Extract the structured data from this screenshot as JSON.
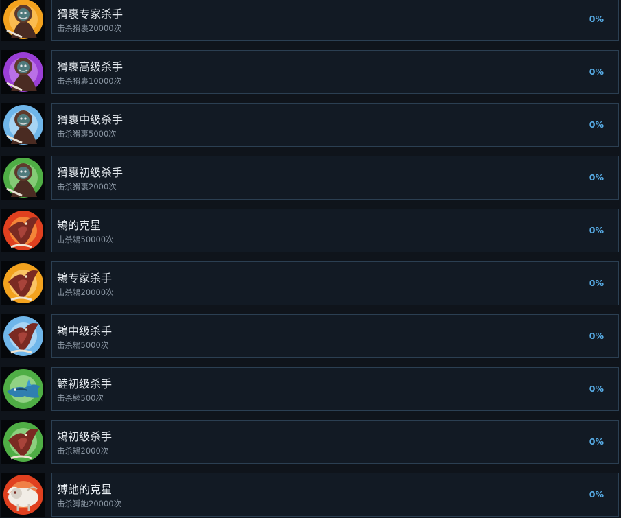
{
  "achievements": [
    {
      "title": "猾褢专家杀手",
      "desc": "击杀猾褢20000次",
      "progress": "0%",
      "icon": "masked-beast-icon",
      "tier": "gold"
    },
    {
      "title": "猾褢高级杀手",
      "desc": "击杀猾褢10000次",
      "progress": "0%",
      "icon": "masked-beast-icon",
      "tier": "purple"
    },
    {
      "title": "猾褢中级杀手",
      "desc": "击杀猾褢5000次",
      "progress": "0%",
      "icon": "masked-beast-icon",
      "tier": "blue"
    },
    {
      "title": "猾褢初级杀手",
      "desc": "击杀猾褢2000次",
      "progress": "0%",
      "icon": "masked-beast-icon",
      "tier": "green"
    },
    {
      "title": "鴸的克星",
      "desc": "击杀鴸50000次",
      "progress": "0%",
      "icon": "red-bird-icon",
      "tier": "red"
    },
    {
      "title": "鴸专家杀手",
      "desc": "击杀鴸20000次",
      "progress": "0%",
      "icon": "red-bird-icon",
      "tier": "gold"
    },
    {
      "title": "鴸中级杀手",
      "desc": "击杀鴸5000次",
      "progress": "0%",
      "icon": "red-bird-icon",
      "tier": "blue"
    },
    {
      "title": "鯥初级杀手",
      "desc": "击杀鯥500次",
      "progress": "0%",
      "icon": "blue-fish-beast-icon",
      "tier": "green"
    },
    {
      "title": "鴸初级杀手",
      "desc": "击杀鴸2000次",
      "progress": "0%",
      "icon": "red-bird-icon",
      "tier": "green"
    },
    {
      "title": "猼訑的克星",
      "desc": "击杀猼訑20000次",
      "progress": "0%",
      "icon": "white-goat-icon",
      "tier": "red"
    }
  ],
  "colors": {
    "background": "#0f141b",
    "card": "#121a24",
    "card_border": "#2b3f52",
    "title": "#e8edf2",
    "desc": "#8a96a3",
    "progress": "#58aee8",
    "tier_gold": "#f3a21e",
    "tier_purple": "#9a3fd6",
    "tier_blue": "#6fb6ea",
    "tier_green": "#4fae45",
    "tier_red": "#e0401f"
  }
}
